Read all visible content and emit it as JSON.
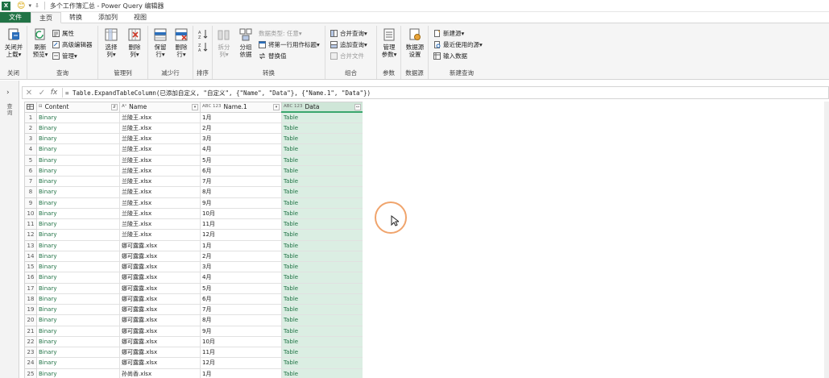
{
  "titlebar": {
    "app_glyph": "X",
    "smiley_glyph": "😊",
    "quick_dropdown": "▾",
    "quick_more": "⇩",
    "title": "多个工作簿汇总 - Power Query 编辑器"
  },
  "tabs": [
    "文件",
    "主页",
    "转换",
    "添加列",
    "视图"
  ],
  "ribbon": {
    "close": {
      "label1": "关闭并",
      "label2": "上载▾",
      "group": "关闭"
    },
    "query": {
      "refresh1": "刷新",
      "refresh2": "预览▾",
      "props": "属性",
      "adv": "高级编辑器",
      "manage": "管理▾",
      "group": "查询"
    },
    "columns": {
      "choose1": "选择",
      "choose2": "列▾",
      "remove1": "删除",
      "remove2": "列▾",
      "group": "管理列"
    },
    "rows": {
      "keep1": "保留",
      "keep2": "行▾",
      "remove1": "删除",
      "remove2": "行▾",
      "group": "减少行"
    },
    "sort": {
      "group": "排序"
    },
    "transform": {
      "split1": "拆分",
      "split2": "列▾",
      "groupby1": "分组",
      "groupby2": "依据",
      "dtype": "数据类型: 任意▾",
      "firstrow": "将第一行用作标题▾",
      "replace": "替换值",
      "group": "转换"
    },
    "combine": {
      "merge": "合并查询▾",
      "append": "追加查询▾",
      "files": "合并文件",
      "group": "组合"
    },
    "params": {
      "manage1": "管理",
      "manage2": "参数▾",
      "group": "参数"
    },
    "datasource": {
      "settings1": "数据源",
      "settings2": "设置",
      "group": "数据源"
    },
    "newquery": {
      "newsrc": "新建源▾",
      "recent": "最近使用的源▾",
      "enter": "输入数据",
      "group": "新建查询"
    }
  },
  "formula_bar": {
    "cancel_glyph": "✕",
    "confirm_glyph": "✓",
    "fx": "fx",
    "formula": "= Table.ExpandTableColumn(已添加自定义, \"自定义\", {\"Name\", \"Data\"}, {\"Name.1\", \"Data\"})"
  },
  "queries_pane": {
    "expand_glyph": "›",
    "label": "查询"
  },
  "grid": {
    "columns": [
      {
        "type": "⊟",
        "label": "Content",
        "dd": "⇵"
      },
      {
        "type": "Aᴬ",
        "label": "Name",
        "dd": "▾"
      },
      {
        "type": "ABC 123",
        "label": "Name.1",
        "dd": "▾"
      },
      {
        "type": "ABC 123",
        "label": "Data",
        "dd": "↔"
      }
    ],
    "rows": [
      {
        "n": "1",
        "content": "Binary",
        "name": "兰陵王.xlsx",
        "name1": "1月",
        "data": "Table"
      },
      {
        "n": "2",
        "content": "Binary",
        "name": "兰陵王.xlsx",
        "name1": "2月",
        "data": "Table"
      },
      {
        "n": "3",
        "content": "Binary",
        "name": "兰陵王.xlsx",
        "name1": "3月",
        "data": "Table"
      },
      {
        "n": "4",
        "content": "Binary",
        "name": "兰陵王.xlsx",
        "name1": "4月",
        "data": "Table"
      },
      {
        "n": "5",
        "content": "Binary",
        "name": "兰陵王.xlsx",
        "name1": "5月",
        "data": "Table"
      },
      {
        "n": "6",
        "content": "Binary",
        "name": "兰陵王.xlsx",
        "name1": "6月",
        "data": "Table"
      },
      {
        "n": "7",
        "content": "Binary",
        "name": "兰陵王.xlsx",
        "name1": "7月",
        "data": "Table"
      },
      {
        "n": "8",
        "content": "Binary",
        "name": "兰陵王.xlsx",
        "name1": "8月",
        "data": "Table"
      },
      {
        "n": "9",
        "content": "Binary",
        "name": "兰陵王.xlsx",
        "name1": "9月",
        "data": "Table"
      },
      {
        "n": "10",
        "content": "Binary",
        "name": "兰陵王.xlsx",
        "name1": "10月",
        "data": "Table"
      },
      {
        "n": "11",
        "content": "Binary",
        "name": "兰陵王.xlsx",
        "name1": "11月",
        "data": "Table"
      },
      {
        "n": "12",
        "content": "Binary",
        "name": "兰陵王.xlsx",
        "name1": "12月",
        "data": "Table"
      },
      {
        "n": "13",
        "content": "Binary",
        "name": "娜可露露.xlsx",
        "name1": "1月",
        "data": "Table"
      },
      {
        "n": "14",
        "content": "Binary",
        "name": "娜可露露.xlsx",
        "name1": "2月",
        "data": "Table"
      },
      {
        "n": "15",
        "content": "Binary",
        "name": "娜可露露.xlsx",
        "name1": "3月",
        "data": "Table"
      },
      {
        "n": "16",
        "content": "Binary",
        "name": "娜可露露.xlsx",
        "name1": "4月",
        "data": "Table"
      },
      {
        "n": "17",
        "content": "Binary",
        "name": "娜可露露.xlsx",
        "name1": "5月",
        "data": "Table"
      },
      {
        "n": "18",
        "content": "Binary",
        "name": "娜可露露.xlsx",
        "name1": "6月",
        "data": "Table"
      },
      {
        "n": "19",
        "content": "Binary",
        "name": "娜可露露.xlsx",
        "name1": "7月",
        "data": "Table"
      },
      {
        "n": "20",
        "content": "Binary",
        "name": "娜可露露.xlsx",
        "name1": "8月",
        "data": "Table"
      },
      {
        "n": "21",
        "content": "Binary",
        "name": "娜可露露.xlsx",
        "name1": "9月",
        "data": "Table"
      },
      {
        "n": "22",
        "content": "Binary",
        "name": "娜可露露.xlsx",
        "name1": "10月",
        "data": "Table"
      },
      {
        "n": "23",
        "content": "Binary",
        "name": "娜可露露.xlsx",
        "name1": "11月",
        "data": "Table"
      },
      {
        "n": "24",
        "content": "Binary",
        "name": "娜可露露.xlsx",
        "name1": "12月",
        "data": "Table"
      },
      {
        "n": "25",
        "content": "Binary",
        "name": "孙尚香.xlsx",
        "name1": "1月",
        "data": "Table"
      }
    ]
  },
  "colors": {
    "accent": "#217346",
    "selected_col": "#dbeee3",
    "cursor_ring": "#f0a46c"
  }
}
